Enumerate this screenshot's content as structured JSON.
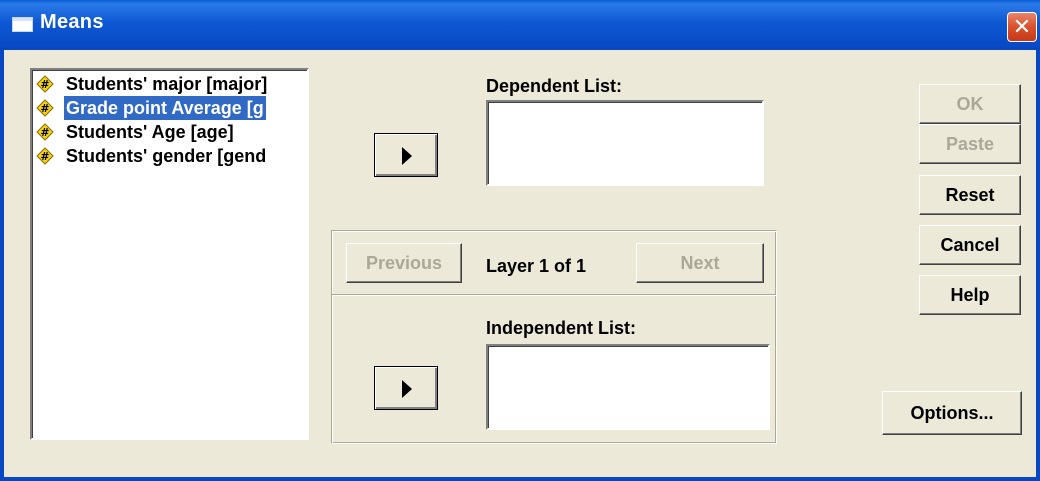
{
  "window": {
    "title": "Means",
    "close_glyph": "✕"
  },
  "variables": {
    "items": [
      {
        "label": "Students' major [major]",
        "icon": "scale-variable-icon",
        "selected": false
      },
      {
        "label": "Grade point Average [g",
        "icon": "scale-variable-icon",
        "selected": true
      },
      {
        "label": "Students' Age [age]",
        "icon": "scale-variable-icon",
        "selected": false
      },
      {
        "label": "Students' gender [gend",
        "icon": "scale-variable-icon",
        "selected": false
      }
    ]
  },
  "dependent": {
    "label": "Dependent List:",
    "move_icon": "arrow-right-icon"
  },
  "layer": {
    "previous_label": "Previous",
    "status": "Layer 1 of 1",
    "next_label": "Next"
  },
  "independent": {
    "label": "Independent List:",
    "move_icon": "arrow-right-icon"
  },
  "buttons": {
    "ok": "OK",
    "paste": "Paste",
    "reset": "Reset",
    "cancel": "Cancel",
    "help": "Help",
    "options": "Options..."
  },
  "colors": {
    "titlebar": "#0a5fd6",
    "selection": "#316ac5",
    "dialog_bg": "#ece9d8",
    "close_button": "#d9512c"
  }
}
